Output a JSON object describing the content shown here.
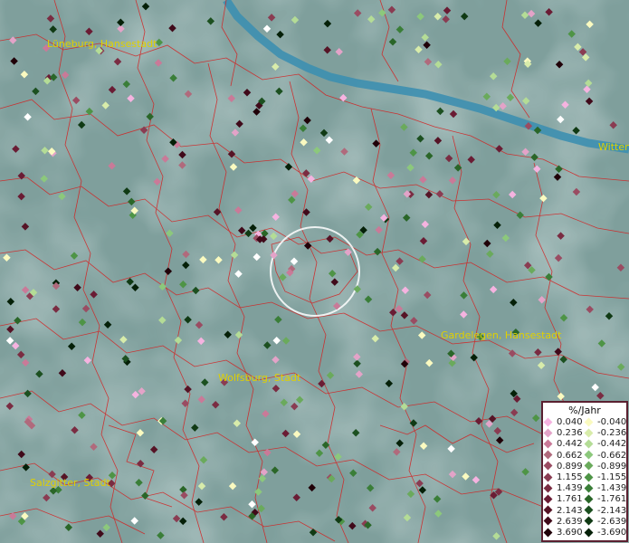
{
  "map": {
    "colors": {
      "background": "#7f9f9c",
      "river": "#3d8fb0",
      "boundary": "#d42020"
    },
    "cities": [
      {
        "id": "lueneburg",
        "label": "Lüneburg, Hansestadt"
      },
      {
        "id": "wittenberge",
        "label": "Wittenb"
      },
      {
        "id": "gardelegen",
        "label": "Gardelegen, Hansestadt"
      },
      {
        "id": "wolfsburg",
        "label": "Wolfsburg, Stadt"
      },
      {
        "id": "salzgitter",
        "label": "Salzgitter, Stadt"
      }
    ]
  },
  "legend": {
    "title": "%/Jahr",
    "positive": [
      {
        "label": "0.040",
        "color": "#f5b3e0"
      },
      {
        "label": "0.236",
        "color": "#e3a3c8"
      },
      {
        "label": "0.442",
        "color": "#c97a98"
      },
      {
        "label": "0.662",
        "color": "#b06a7c"
      },
      {
        "label": "0.899",
        "color": "#9a4c62"
      },
      {
        "label": "1.155",
        "color": "#8a3c52"
      },
      {
        "label": "1.439",
        "color": "#7a2c42"
      },
      {
        "label": "1.761",
        "color": "#6a1c34"
      },
      {
        "label": "2.143",
        "color": "#561426"
      },
      {
        "label": "2.639",
        "color": "#400a1a"
      },
      {
        "label": "3.690",
        "color": "#200008"
      }
    ],
    "negative": [
      {
        "label": "-0.040",
        "color": "#fafac0"
      },
      {
        "label": "-0.236",
        "color": "#d8ecaa"
      },
      {
        "label": "-0.442",
        "color": "#b4dc96"
      },
      {
        "label": "-0.662",
        "color": "#8cc87c"
      },
      {
        "label": "-0.899",
        "color": "#6aaa5c"
      },
      {
        "label": "-1.155",
        "color": "#4e9446"
      },
      {
        "label": "-1.439",
        "color": "#3a7e38"
      },
      {
        "label": "-1.761",
        "color": "#2a6628"
      },
      {
        "label": "-2.143",
        "color": "#1c5020"
      },
      {
        "label": "-2.639",
        "color": "#103a14"
      },
      {
        "label": "-3.690",
        "color": "#052008"
      }
    ]
  }
}
